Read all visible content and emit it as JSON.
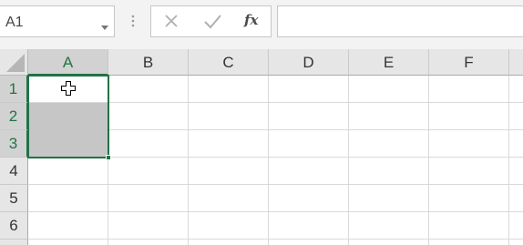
{
  "formula_bar": {
    "name_box_value": "A1",
    "function_label": "fx",
    "formula_value": ""
  },
  "grid": {
    "columns": [
      "A",
      "B",
      "C",
      "D",
      "E",
      "F"
    ],
    "rows": [
      "1",
      "2",
      "3",
      "4",
      "5",
      "6"
    ],
    "selected_range": "A1:A3",
    "active_cell": "A1"
  },
  "colors": {
    "accent": "#217346",
    "selection_fill": "#c6c6c6",
    "header_bg": "#e6e6e6"
  },
  "icons": [
    "dropdown-arrow-icon",
    "grip-icon",
    "cancel-icon",
    "enter-checkmark-icon",
    "insert-function-icon",
    "select-all-triangle-icon",
    "cell-cursor-icon"
  ]
}
